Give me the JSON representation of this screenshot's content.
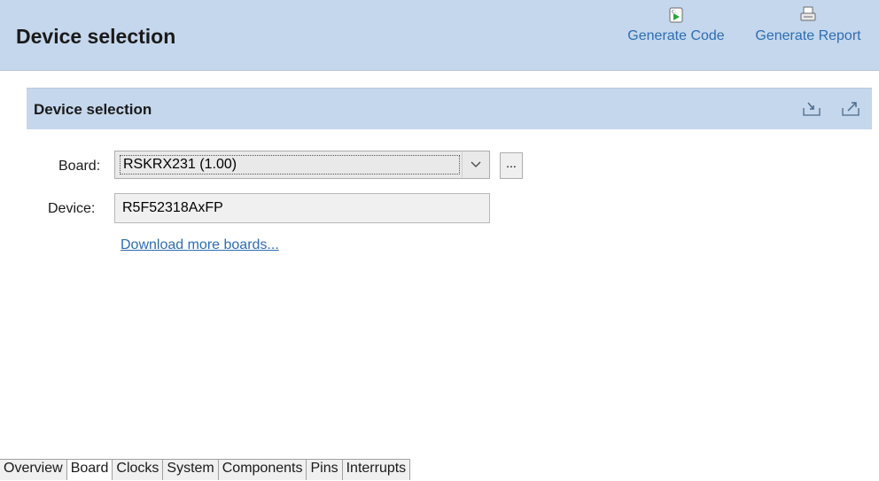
{
  "header": {
    "title": "Device selection",
    "generate_code_label": "Generate Code",
    "generate_report_label": "Generate Report"
  },
  "section": {
    "title": "Device selection"
  },
  "form": {
    "board_label": "Board:",
    "board_value": "RSKRX231 (1.00)",
    "browse_label": "...",
    "device_label": "Device:",
    "device_value": "R5F52318AxFP",
    "download_link": "Download more boards..."
  },
  "tabs": [
    {
      "label": "Overview",
      "active": false
    },
    {
      "label": "Board",
      "active": true
    },
    {
      "label": "Clocks",
      "active": false
    },
    {
      "label": "System",
      "active": false
    },
    {
      "label": "Components",
      "active": false
    },
    {
      "label": "Pins",
      "active": false
    },
    {
      "label": "Interrupts",
      "active": false
    }
  ],
  "colors": {
    "header_bg": "#c5d7ec",
    "link": "#2e6db2"
  },
  "icons": {
    "generate_code": "generate-code-icon",
    "generate_report": "generate-report-icon",
    "import": "import-icon",
    "export": "export-icon",
    "dropdown": "chevron-down-icon"
  }
}
